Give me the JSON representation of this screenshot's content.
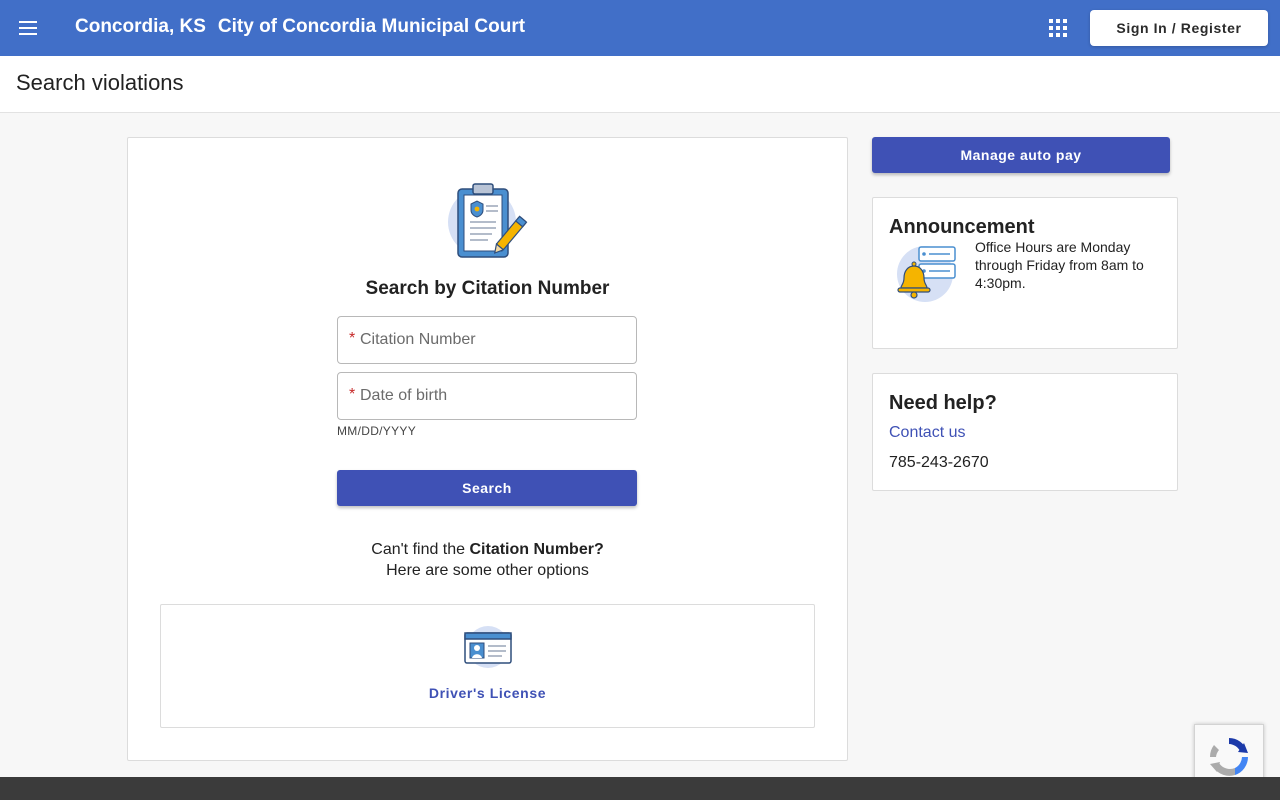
{
  "header": {
    "menu_icon": "hamburger-menu-icon",
    "location": "Concordia, KS",
    "court_name": "City of Concordia Municipal Court",
    "apps_icon": "apps-grid-icon",
    "signin_label": "Sign In / Register",
    "color": "#416fc8"
  },
  "page": {
    "title": "Search violations"
  },
  "search": {
    "icon": "clipboard-citation-icon",
    "title": "Search by Citation Number",
    "required_mark": "*",
    "citation_placeholder": "Citation Number",
    "dob_placeholder": "Date of birth",
    "dob_hint": "MM/DD/YYYY",
    "button_label": "Search",
    "cant_find_prefix": "Can't find the",
    "cant_find_bold": "Citation Number?",
    "other_options": "Here are some other options",
    "accent_color": "#3f51b5"
  },
  "options": [
    {
      "icon": "id-card-icon",
      "label": "Driver's License"
    }
  ],
  "sidebar": {
    "autopay_label": "Manage auto pay",
    "announcement": {
      "heading": "Announcement",
      "icon": "bell-notification-icon",
      "text": "Office Hours are Monday through Friday from 8am to 4:30pm."
    },
    "help": {
      "heading": "Need help?",
      "contact_label": "Contact us",
      "phone": "785-243-2670"
    }
  },
  "recaptcha": {
    "icon": "recaptcha-icon"
  }
}
